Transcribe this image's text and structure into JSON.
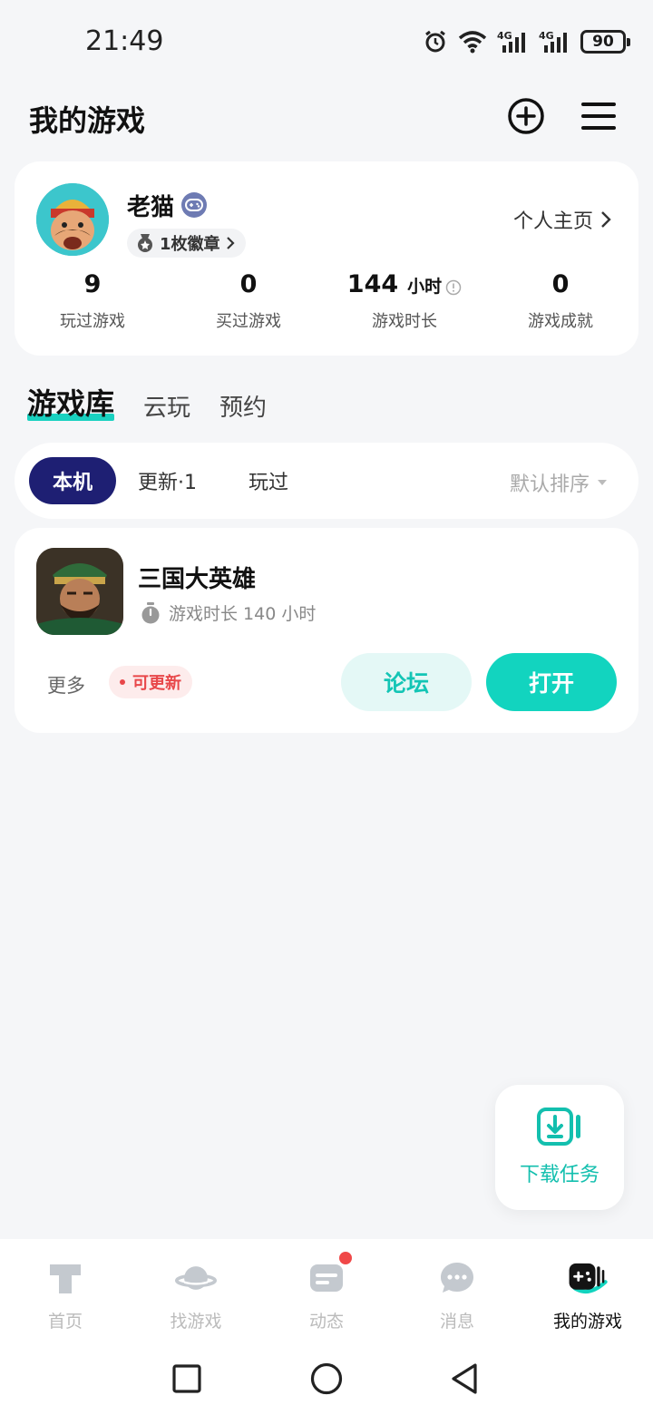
{
  "status_bar": {
    "time": "21:49",
    "battery": "90"
  },
  "header": {
    "title": "我的游戏"
  },
  "profile": {
    "username": "老猫",
    "medal_text": "1枚徽章",
    "homepage_link": "个人主页",
    "stats": [
      {
        "value": "9",
        "unit": "",
        "label": "玩过游戏"
      },
      {
        "value": "0",
        "unit": "",
        "label": "买过游戏"
      },
      {
        "value": "144",
        "unit": "小时",
        "label": "游戏时长"
      },
      {
        "value": "0",
        "unit": "",
        "label": "游戏成就"
      }
    ]
  },
  "main_tabs": [
    {
      "label": "游戏库",
      "active": true
    },
    {
      "label": "云玩",
      "active": false
    },
    {
      "label": "预约",
      "active": false
    }
  ],
  "filters": {
    "chips": [
      {
        "label": "本机",
        "active": true
      },
      {
        "label": "更新·1",
        "active": false
      },
      {
        "label": "玩过",
        "active": false
      }
    ],
    "sort_label": "默认排序"
  },
  "game": {
    "name": "三国大英雄",
    "playtime": "游戏时长 140 小时",
    "more_label": "更多",
    "update_label": "可更新",
    "forum_label": "论坛",
    "open_label": "打开"
  },
  "download_task": {
    "label": "下载任务"
  },
  "bottom_nav": [
    {
      "label": "首页",
      "icon": "home-icon",
      "active": false
    },
    {
      "label": "找游戏",
      "icon": "planet-icon",
      "active": false
    },
    {
      "label": "动态",
      "icon": "feed-icon",
      "active": false,
      "has_dot": true
    },
    {
      "label": "消息",
      "icon": "message-icon",
      "active": false
    },
    {
      "label": "我的游戏",
      "icon": "gamepad-icon",
      "active": true
    }
  ],
  "colors": {
    "accent": "#12d4bf",
    "active_chip": "#1e1f73",
    "update_red": "#e8474a",
    "background": "#f5f6f8"
  }
}
